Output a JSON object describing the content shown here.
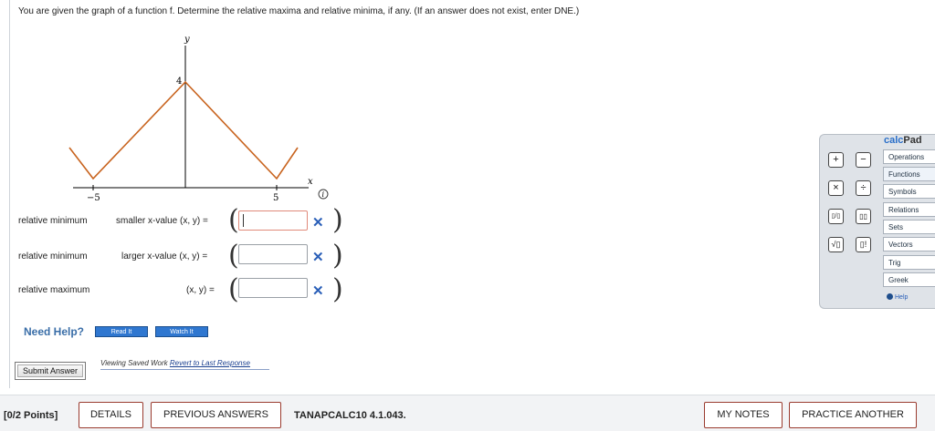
{
  "question": {
    "prompt": "You are given the graph of a function f. Determine the relative maxima and relative minima, if any. (If an answer does not exist, enter DNE.)"
  },
  "graph": {
    "x_axis_label": "x",
    "y_axis_label": "y",
    "x_tick_labels": [
      "−5",
      "5"
    ],
    "y_tick_labels": [
      "4"
    ],
    "info_icon": "info-icon",
    "curve_color": "#c8631e"
  },
  "answers": [
    {
      "label": "relative minimum",
      "sublabel": "smaller x-value (x, y) =",
      "value": "",
      "status_icon": "close-icon"
    },
    {
      "label": "relative minimum",
      "sublabel": "larger x-value (x, y) =",
      "value": "",
      "status_icon": "close-icon"
    },
    {
      "label": "relative maximum",
      "sublabel": "(x, y) =",
      "value": "",
      "status_icon": "close-icon"
    }
  ],
  "help": {
    "label": "Need Help?",
    "read_button": "Read It",
    "watch_button": "Watch It"
  },
  "submit": {
    "button_label": "Submit Answer",
    "viewing_text": "Viewing Saved Work",
    "revert_link": "Revert to Last Response"
  },
  "calcpad": {
    "title_c": "calc",
    "title_rest": "Pad",
    "tabs": [
      "Operations",
      "Functions",
      "Symbols",
      "Relations",
      "Sets",
      "Vectors",
      "Trig",
      "Greek"
    ],
    "help_label": "Help",
    "keys": [
      "+",
      "−",
      "×",
      "÷",
      "▯/▯",
      "▯▯",
      "√▯",
      "▯!"
    ]
  },
  "bottom_bar": {
    "points": "[0/2 Points]",
    "details": "DETAILS",
    "previous_answers": "PREVIOUS ANSWERS",
    "problem_id": "TANAPCALC10 4.1.043.",
    "my_notes": "MY NOTES",
    "practice_another": "PRACTICE ANOTHER"
  },
  "colors": {
    "accent_blue": "#2f77d0",
    "incorrect_mark": "#2a5fb8",
    "button_border": "#9a3b2f"
  }
}
